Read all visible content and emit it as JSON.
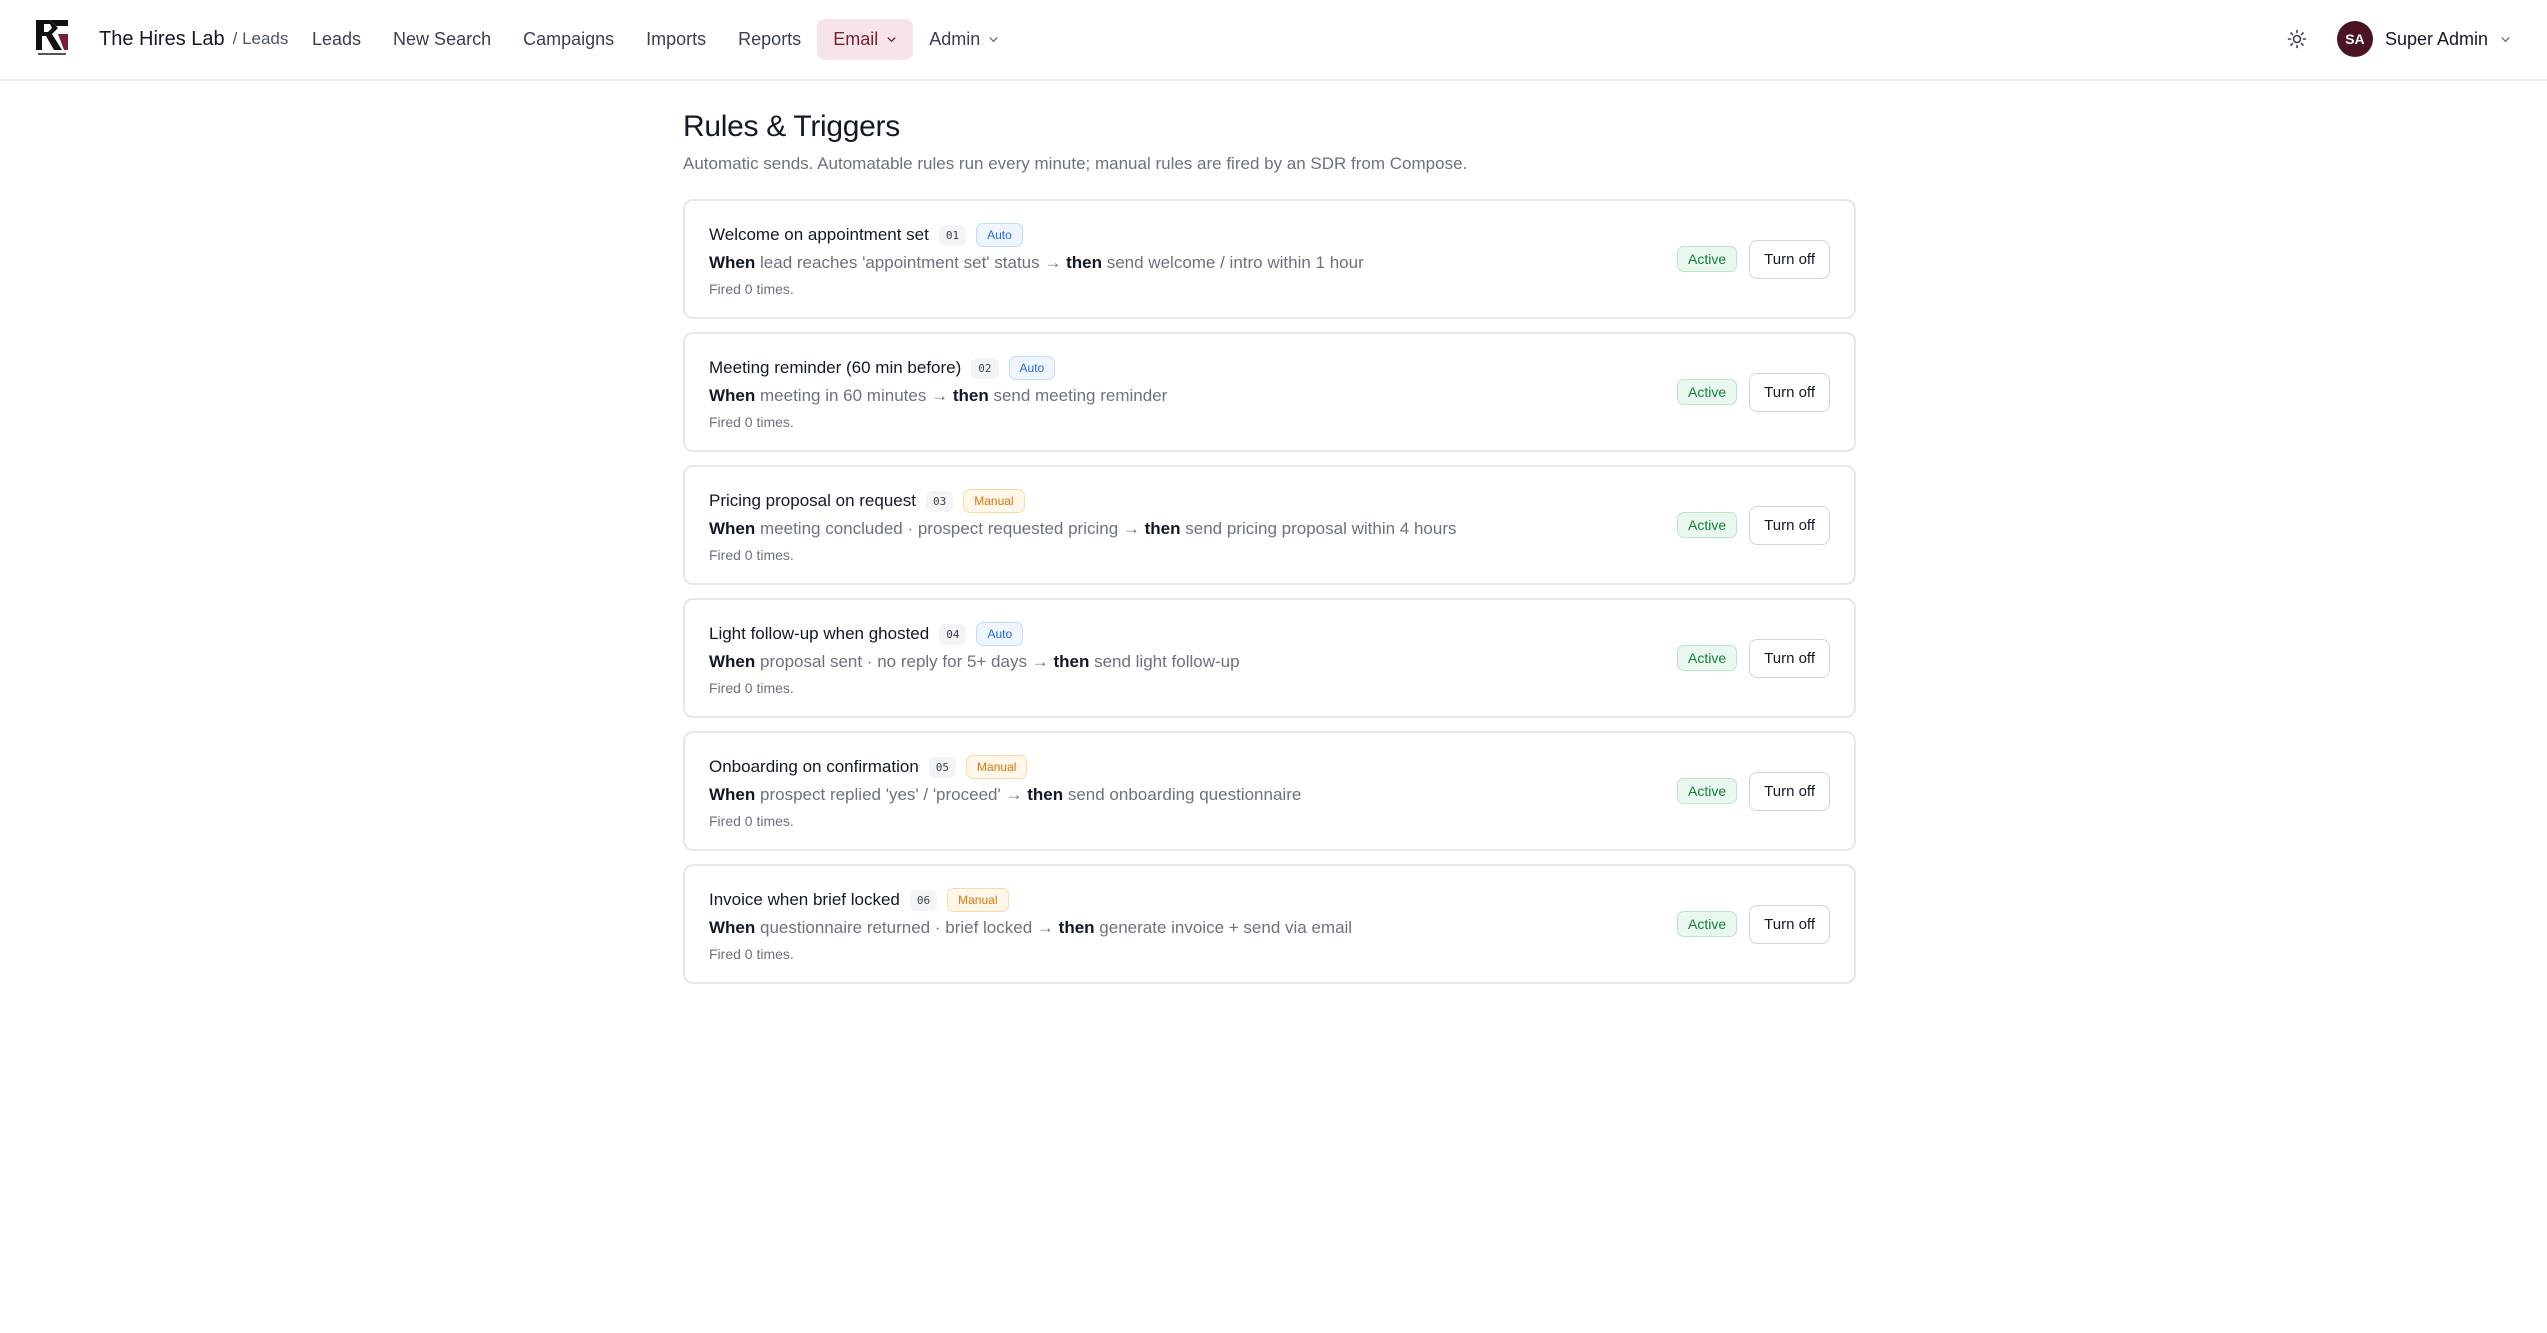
{
  "header": {
    "brand_name": "The Hires Lab",
    "brand_sub": "/ Leads",
    "nav": [
      {
        "label": "Leads"
      },
      {
        "label": "New Search"
      },
      {
        "label": "Campaigns"
      },
      {
        "label": "Imports"
      },
      {
        "label": "Reports"
      },
      {
        "label": "Email"
      },
      {
        "label": "Admin"
      }
    ],
    "active_nav": "Email",
    "user": {
      "initials": "SA",
      "name": "Super Admin"
    }
  },
  "page": {
    "title": "Rules & Triggers",
    "subtitle": "Automatic sends. Automatable rules run every minute; manual rules are fired by an SDR from Compose."
  },
  "labels": {
    "when": "When",
    "then": "then",
    "arrow": "→",
    "turn_off": "Turn off"
  },
  "rules": [
    {
      "title": "Welcome on appointment set",
      "num": "01",
      "mode": "Auto",
      "condition": "lead reaches 'appointment set' status",
      "action": "send welcome / intro within 1 hour",
      "fired": "Fired 0 times.",
      "status": "Active"
    },
    {
      "title": "Meeting reminder (60 min before)",
      "num": "02",
      "mode": "Auto",
      "condition": "meeting in 60 minutes",
      "action": "send meeting reminder",
      "fired": "Fired 0 times.",
      "status": "Active"
    },
    {
      "title": "Pricing proposal on request",
      "num": "03",
      "mode": "Manual",
      "condition": "meeting concluded · prospect requested pricing",
      "action": "send pricing proposal within 4 hours",
      "fired": "Fired 0 times.",
      "status": "Active"
    },
    {
      "title": "Light follow-up when ghosted",
      "num": "04",
      "mode": "Auto",
      "condition": "proposal sent · no reply for 5+ days",
      "action": "send light follow-up",
      "fired": "Fired 0 times.",
      "status": "Active"
    },
    {
      "title": "Onboarding on confirmation",
      "num": "05",
      "mode": "Manual",
      "condition": "prospect replied 'yes' / 'proceed'",
      "action": "send onboarding questionnaire",
      "fired": "Fired 0 times.",
      "status": "Active"
    },
    {
      "title": "Invoice when brief locked",
      "num": "06",
      "mode": "Manual",
      "condition": "questionnaire returned · brief locked",
      "action": "generate invoice + send via email",
      "fired": "Fired 0 times.",
      "status": "Active"
    }
  ],
  "colors": {
    "brand": "#4a1423",
    "active_nav_bg": "#f7e4e8",
    "auto": "#2563eb",
    "manual": "#d97706",
    "active_status": "#15803d"
  }
}
